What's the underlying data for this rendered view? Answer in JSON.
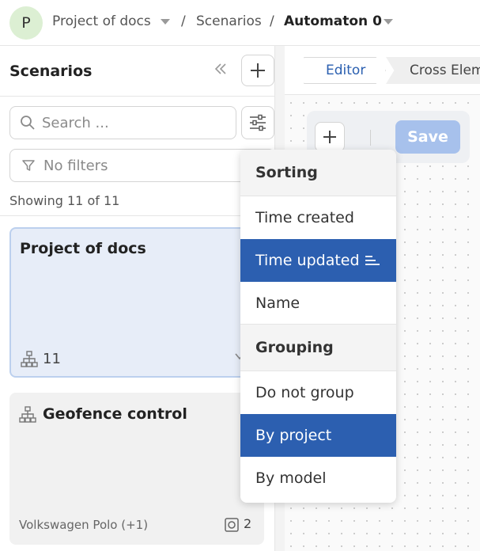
{
  "breadcrumb": {
    "avatar_letter": "P",
    "project": "Project of docs",
    "separator": "/",
    "scenarios": "Scenarios",
    "current": "Automaton 0"
  },
  "sidebar": {
    "title": "Scenarios",
    "search_placeholder": "Search ...",
    "filter_label": "No filters",
    "showing": "Showing 11 of 11",
    "cards": [
      {
        "title": "Project of docs",
        "count": "11"
      },
      {
        "title": "Geofence control",
        "vehicle": "Volkswagen Polo (+1)",
        "device_count": "2"
      }
    ]
  },
  "editor": {
    "tabs": [
      "Editor",
      "Cross Elem"
    ],
    "save_label": "Save"
  },
  "menu": {
    "sorting_header": "Sorting",
    "sorting_items": [
      "Time created",
      "Time updated",
      "Name"
    ],
    "grouping_header": "Grouping",
    "grouping_items": [
      "Do not group",
      "By project",
      "By model"
    ]
  },
  "colors": {
    "accent": "#2c5fb0",
    "avatar_bg": "#dcefd3",
    "selected_card_bg": "#e7edf8",
    "save_disabled": "#a7c1ec"
  },
  "icons": {
    "search": "search-icon",
    "filter": "filter-icon",
    "settings": "sliders-icon",
    "add": "plus-icon",
    "collapse": "double-chevron-left-icon",
    "tree": "hierarchy-icon",
    "device": "device-icon",
    "sort": "sort-descending-icon"
  }
}
